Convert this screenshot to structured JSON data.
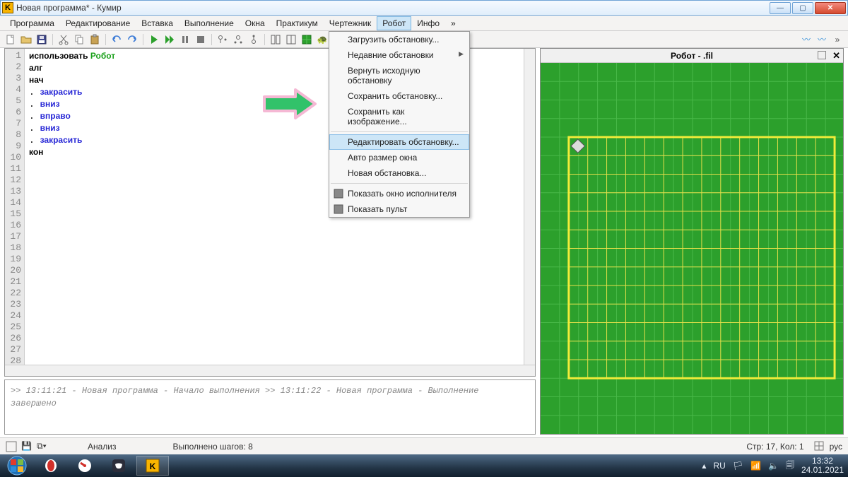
{
  "window": {
    "title": "Новая программа* - Кумир",
    "appBadge": "K"
  },
  "menubar": [
    "Программа",
    "Редактирование",
    "Вставка",
    "Выполнение",
    "Окна",
    "Практикум",
    "Чертежник",
    "Робот",
    "Инфо",
    "»"
  ],
  "activeMenuIndex": 7,
  "dropdown": {
    "items": [
      {
        "label": "Загрузить обстановку...",
        "type": "item"
      },
      {
        "label": "Недавние обстановки",
        "type": "sub"
      },
      {
        "label": "Вернуть исходную обстановку",
        "type": "item"
      },
      {
        "label": "Сохранить обстановку...",
        "type": "item"
      },
      {
        "label": "Сохранить как изображение...",
        "type": "item"
      },
      {
        "type": "sep"
      },
      {
        "label": "Редактировать обстановку...",
        "type": "item",
        "highlight": true
      },
      {
        "label": "Авто размер окна",
        "type": "item"
      },
      {
        "label": "Новая обстановка...",
        "type": "item"
      },
      {
        "type": "sep"
      },
      {
        "label": "Показать окно исполнителя",
        "type": "item",
        "icon": "window"
      },
      {
        "label": "Показать пульт",
        "type": "item",
        "icon": "remote"
      }
    ]
  },
  "code": {
    "lines": [
      {
        "n": 1,
        "segs": [
          {
            "t": "использовать ",
            "c": "kw"
          },
          {
            "t": "Робот",
            "c": "ex"
          }
        ]
      },
      {
        "n": 2,
        "segs": [
          {
            "t": "алг",
            "c": "kw"
          }
        ]
      },
      {
        "n": 3,
        "segs": [
          {
            "t": "нач",
            "c": "kw"
          }
        ]
      },
      {
        "n": 4,
        "segs": [
          {
            "t": ". ",
            "c": ""
          },
          {
            "t": "закрасить",
            "c": "cmd"
          }
        ]
      },
      {
        "n": 5,
        "segs": [
          {
            "t": ". ",
            "c": ""
          },
          {
            "t": "вниз",
            "c": "cmd"
          }
        ]
      },
      {
        "n": 6,
        "segs": [
          {
            "t": ". ",
            "c": ""
          },
          {
            "t": "вправо",
            "c": "cmd"
          }
        ]
      },
      {
        "n": 7,
        "segs": [
          {
            "t": ". ",
            "c": ""
          },
          {
            "t": "вниз",
            "c": "cmd"
          }
        ]
      },
      {
        "n": 8,
        "segs": [
          {
            "t": ". ",
            "c": ""
          },
          {
            "t": "закрасить",
            "c": "cmd"
          }
        ]
      },
      {
        "n": 9,
        "segs": [
          {
            "t": "кон",
            "c": "kw"
          }
        ]
      }
    ],
    "totalLines": 28
  },
  "console": [
    ">> 13:11:21 - Новая программа - Начало выполнения",
    "",
    ">> 13:11:22 - Новая программа - Выполнение завершено"
  ],
  "robot": {
    "title": "Робот - .fil"
  },
  "status": {
    "analysis": "Анализ",
    "steps": "Выполнено шагов: 8",
    "pos": "Стр: 17, Кол: 1",
    "lang": "рус"
  },
  "tray": {
    "kb": "RU",
    "time": "13:32",
    "date": "24.01.2021"
  }
}
